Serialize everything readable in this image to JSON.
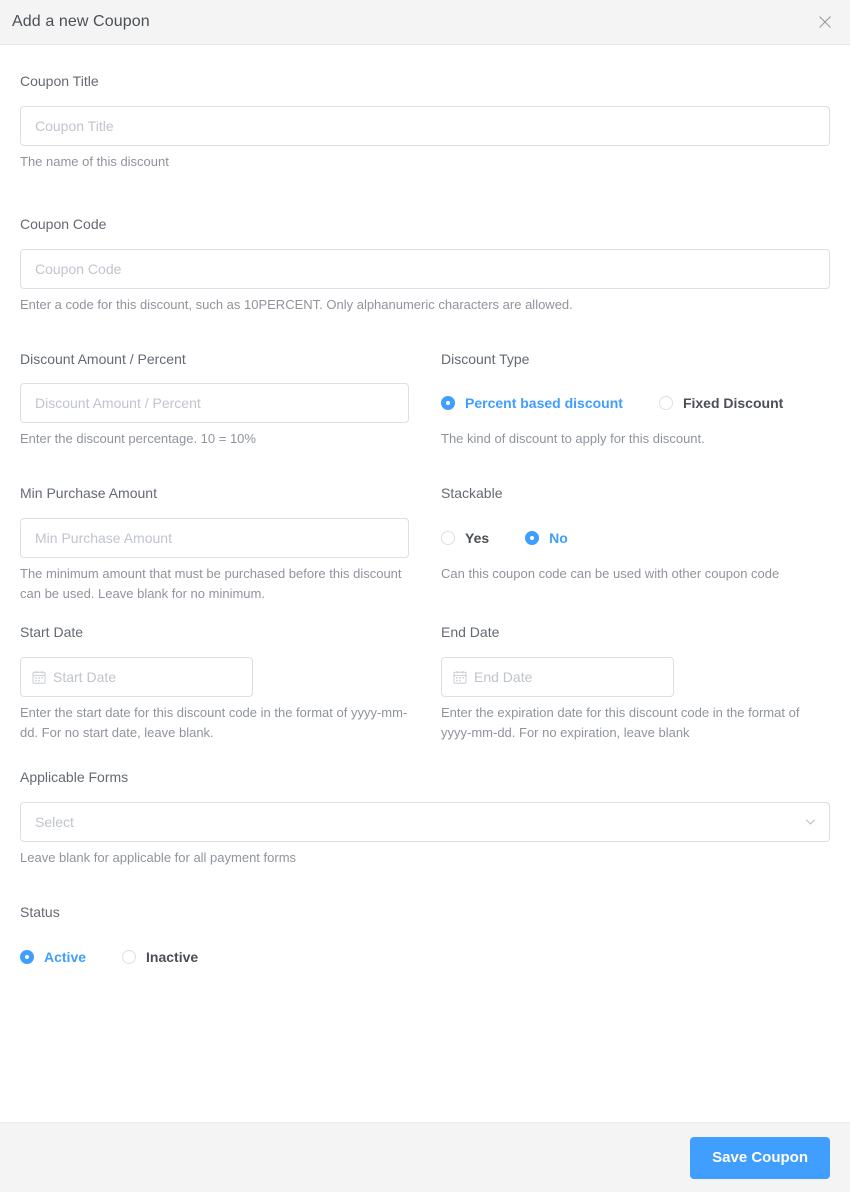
{
  "dialog": {
    "title": "Add a new Coupon",
    "close_icon": "close-icon"
  },
  "fields": {
    "coupon_title": {
      "label": "Coupon Title",
      "placeholder": "Coupon Title",
      "value": "",
      "help": "The name of this discount"
    },
    "coupon_code": {
      "label": "Coupon Code",
      "placeholder": "Coupon Code",
      "value": "",
      "help": "Enter a code for this discount, such as 10PERCENT. Only alphanumeric characters are allowed."
    },
    "discount_amount": {
      "label": "Discount Amount / Percent",
      "placeholder": "Discount Amount / Percent",
      "value": "",
      "help": "Enter the discount percentage. 10 = 10%"
    },
    "discount_type": {
      "label": "Discount Type",
      "help": "The kind of discount to apply for this discount.",
      "options": [
        {
          "label": "Percent based discount",
          "selected": true
        },
        {
          "label": "Fixed Discount",
          "selected": false
        }
      ]
    },
    "min_purchase": {
      "label": "Min Purchase Amount",
      "placeholder": "Min Purchase Amount",
      "value": "",
      "help": "The minimum amount that must be purchased before this discount can be used. Leave blank for no minimum."
    },
    "stackable": {
      "label": "Stackable",
      "help": "Can this coupon code can be used with other coupon code",
      "options": [
        {
          "label": "Yes",
          "selected": false
        },
        {
          "label": "No",
          "selected": true
        }
      ]
    },
    "start_date": {
      "label": "Start Date",
      "placeholder": "Start Date",
      "value": "",
      "help": "Enter the start date for this discount code in the format of yyyy-mm-dd. For no start date, leave blank.",
      "icon": "calendar-icon"
    },
    "end_date": {
      "label": "End Date",
      "placeholder": "End Date",
      "value": "",
      "help": "Enter the expiration date for this discount code in the format of yyyy-mm-dd. For no expiration, leave blank",
      "icon": "calendar-icon"
    },
    "applicable_forms": {
      "label": "Applicable Forms",
      "placeholder": "Select",
      "value": "",
      "help": "Leave blank for applicable for all payment forms",
      "icon": "chevron-down-icon"
    },
    "status": {
      "label": "Status",
      "options": [
        {
          "label": "Active",
          "selected": true
        },
        {
          "label": "Inactive",
          "selected": false
        }
      ]
    }
  },
  "footer": {
    "save_label": "Save Coupon"
  },
  "colors": {
    "primary": "#409eff",
    "header_bg": "#f4f4f5",
    "border": "#dcdfe6",
    "placeholder": "#c0c4cc",
    "label": "#646a73",
    "help": "#8f949c"
  }
}
